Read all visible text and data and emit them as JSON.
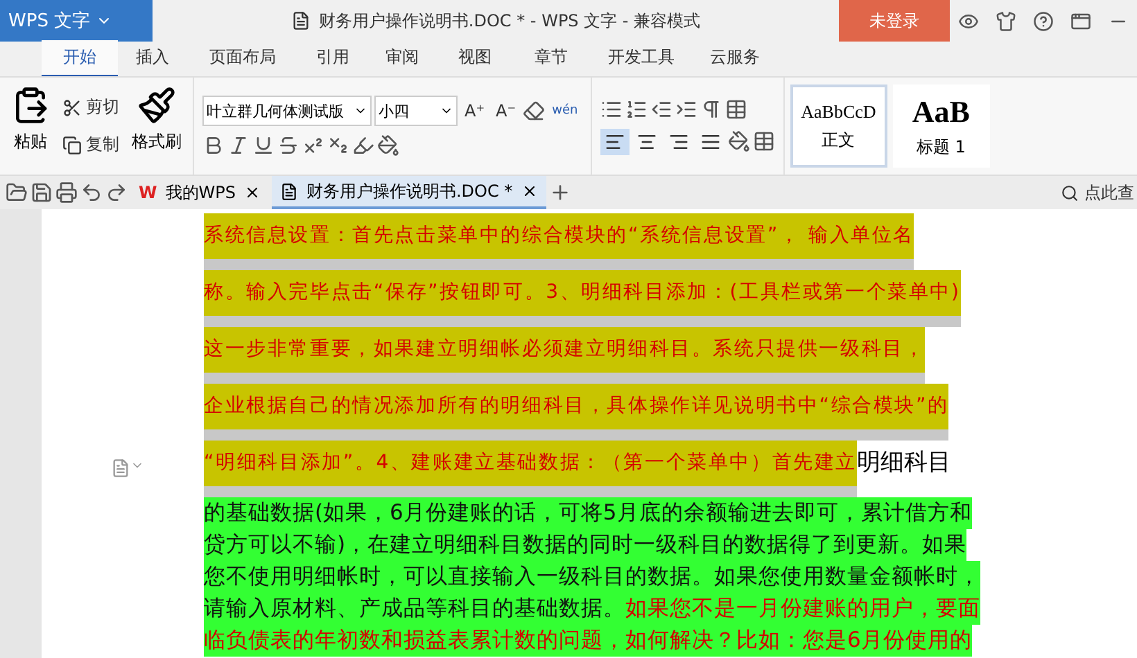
{
  "title_bar": {
    "app_menu": "WPS 文字",
    "title": "财务用户操作说明书.DOC * - WPS 文字 - 兼容模式",
    "login_button": "未登录"
  },
  "ribbon_tabs": [
    {
      "label": "开始",
      "selected": true
    },
    {
      "label": "插入",
      "selected": false
    },
    {
      "label": "页面布局",
      "selected": false
    },
    {
      "label": "引用",
      "selected": false
    },
    {
      "label": "审阅",
      "selected": false
    },
    {
      "label": "视图",
      "selected": false
    },
    {
      "label": "章节",
      "selected": false
    },
    {
      "label": "开发工具",
      "selected": false
    },
    {
      "label": "云服务",
      "selected": false
    }
  ],
  "clipboard": {
    "paste": "粘贴",
    "cut": "剪切",
    "copy": "复制",
    "format_painter": "格式刷"
  },
  "font": {
    "name": "叶立群几何体测试版",
    "size": "小四",
    "grow": "A⁺",
    "shrink": "A⁻",
    "phonetic": "wén"
  },
  "alignment": [
    {
      "selected": true
    },
    {
      "selected": false
    },
    {
      "selected": false
    },
    {
      "selected": false
    }
  ],
  "styles": [
    {
      "sample": "AaBbCcD",
      "label": "正文",
      "selected": true
    },
    {
      "sample": "AaB",
      "label": "标题 1",
      "selected": false
    }
  ],
  "doc_tabs": [
    {
      "label": "我的WPS",
      "kind": "home",
      "logo": "W",
      "selected": false
    },
    {
      "label": "财务用户操作说明书.DOC *",
      "kind": "document",
      "selected": true
    }
  ],
  "search": {
    "placeholder": "点此查"
  },
  "document": {
    "lines": [
      {
        "segments": [
          {
            "kind": "marked",
            "text": "系统信息设置：首先点击菜单中的综合模块的“系统信息设置”， 输入单位名"
          }
        ]
      },
      {
        "segments": [
          {
            "kind": "marked",
            "text": "称。输入完毕点击“保存”按钮即可。3、明细科目添加：(工具栏或第一个菜单中)"
          }
        ]
      },
      {
        "segments": [
          {
            "kind": "marked",
            "text": "这一步非常重要，如果建立明细帐必须建立明细科目。系统只提供一级科目，"
          }
        ]
      },
      {
        "segments": [
          {
            "kind": "marked",
            "text": "企业根据自己的情况添加所有的明细科目，具体操作详见说明书中“综合模块”的"
          }
        ]
      },
      {
        "segments": [
          {
            "kind": "marked",
            "text": "“明细科目添加”。4、建账建立基础数据：（第一个菜单中）首先建立"
          },
          {
            "kind": "plain",
            "text": "明细科目"
          }
        ]
      },
      {
        "segments": [
          {
            "kind": "green",
            "text": "的基础数据(如果，6月份建账的话，可将5月底的余额输进去即可，累计借方和"
          }
        ]
      },
      {
        "segments": [
          {
            "kind": "green",
            "text": "贷方可以不输)，在建立明细科目数据的同时一级科目的数据得了到更新。如果"
          }
        ]
      },
      {
        "segments": [
          {
            "kind": "green",
            "text": "您不使用明细帐时，可以直接输入一级科目的数据。如果您使用数量金额帐时，"
          }
        ]
      },
      {
        "segments": [
          {
            "kind": "green",
            "text": "请输入原材料、产成品等科目的基础数据。"
          },
          {
            "kind": "green-red",
            "text": "如果您不是一月份建账的用户，要面"
          }
        ]
      },
      {
        "segments": [
          {
            "kind": "green-red",
            "text": "临负债表的年初数和损益表累计数的问题，如何解决？比如：您是6月份使用的"
          }
        ]
      }
    ]
  }
}
